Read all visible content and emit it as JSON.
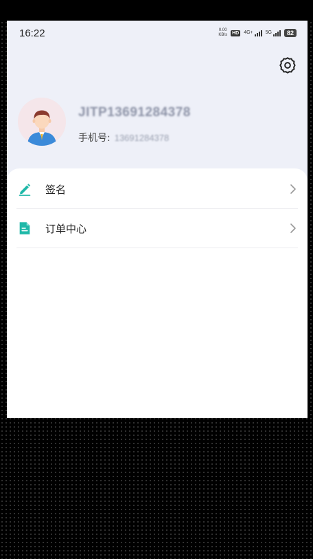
{
  "status_bar": {
    "time": "16:22",
    "net_speed_value": "0.00",
    "net_speed_unit": "KB/s",
    "hd_badge": "HD",
    "sim1_label": "4G+",
    "sim2_label": "5G",
    "battery": "82"
  },
  "profile": {
    "username": "JITP13691284378",
    "phone_label": "手机号:",
    "phone_number": "13691284378"
  },
  "menu": [
    {
      "label": "签名",
      "icon": "pen-edit-icon"
    },
    {
      "label": "订单中心",
      "icon": "order-document-icon"
    }
  ],
  "colors": {
    "accent": "#1fb8a8",
    "header_bg": "#eef0f8",
    "card_bg": "#ffffff"
  }
}
